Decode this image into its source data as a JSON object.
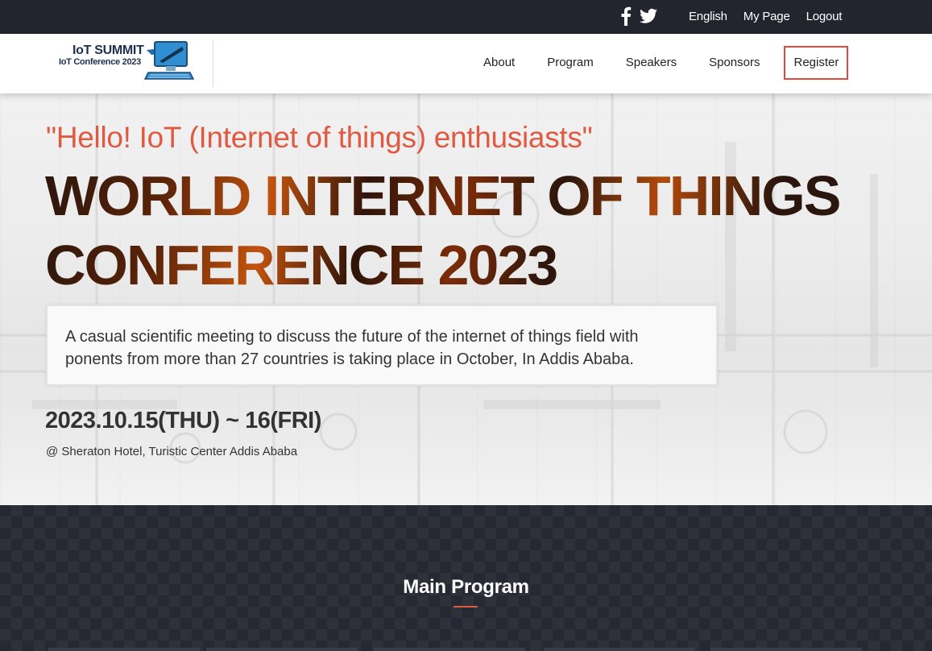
{
  "topbar": {
    "social": [
      "facebook-icon",
      "twitter-icon"
    ],
    "links": {
      "language": "English",
      "my_page": "My Page",
      "logout": "Logout"
    }
  },
  "logo": {
    "line1": "IoT SUMMIT",
    "line2": "IoT Conference 2023"
  },
  "nav": {
    "about": "About",
    "program": "Program",
    "speakers": "Speakers",
    "sponsors": "Sponsors",
    "register": "Register"
  },
  "hero": {
    "tagline": "\"Hello! IoT (Internet of things) enthusiasts\"",
    "title_line1": "WORLD INTERNET OF THINGS",
    "title_line2": "CONFERENCE 2023",
    "description": "A casual scientific meeting to discuss the future of the internet of things field with ponents from more than 27 countries is taking place in October, In Addis Ababa.",
    "date": "2023.10.15(THU) ~ 16(FRI)",
    "venue": "@ Sheraton Hotel, Turistic Center Addis Ababa"
  },
  "section": {
    "title": "Main Program"
  },
  "colors": {
    "topbar": "#22252e",
    "accent": "#e05a42",
    "dark_section": "#262932"
  }
}
